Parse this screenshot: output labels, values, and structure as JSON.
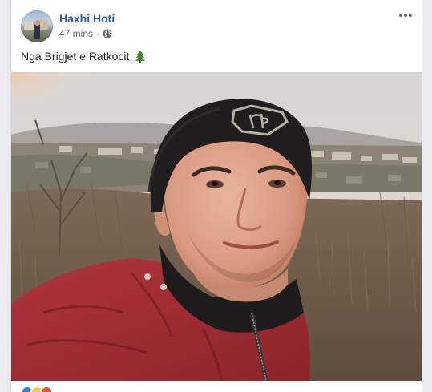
{
  "post": {
    "author": "Haxhi Hoti",
    "time": "47 mins",
    "separator": "·",
    "privacy_icon": "globe-icon",
    "text": "Nga Brigjet e Ratkocit.",
    "text_emoji_icon": "evergreen-tree-icon",
    "photo_alt": "photo",
    "more_icon": "more-options-icon",
    "reactions": [
      {
        "name": "like-reaction-icon",
        "color": "#3b7bd6"
      },
      {
        "name": "love-reaction-icon",
        "color": "#f7c945"
      },
      {
        "name": "wow-reaction-icon",
        "color": "#e5503b"
      }
    ]
  },
  "colors": {
    "author": "#385898",
    "meta": "#616770",
    "text": "#1c1e21",
    "background": "#e9ebee"
  }
}
